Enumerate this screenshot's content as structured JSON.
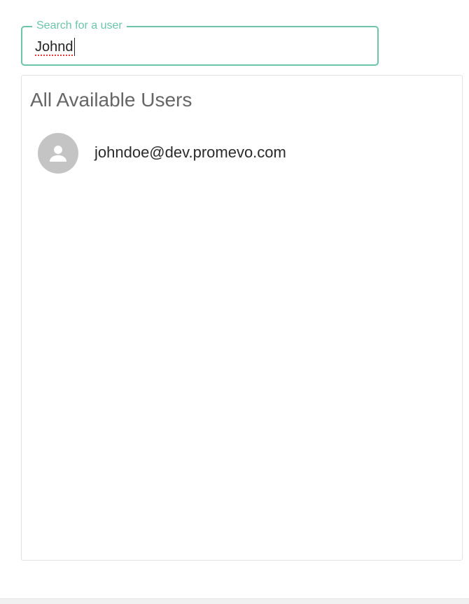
{
  "search": {
    "label": "Search for a user",
    "value": "Johnd"
  },
  "panel": {
    "title": "All Available Users",
    "users": [
      {
        "email": "johndoe@dev.promevo.com",
        "avatar_icon": "person-icon"
      }
    ]
  },
  "colors": {
    "accent": "#6cc5a7",
    "avatar_bg": "#c4c4c4",
    "title_text": "#666666"
  }
}
